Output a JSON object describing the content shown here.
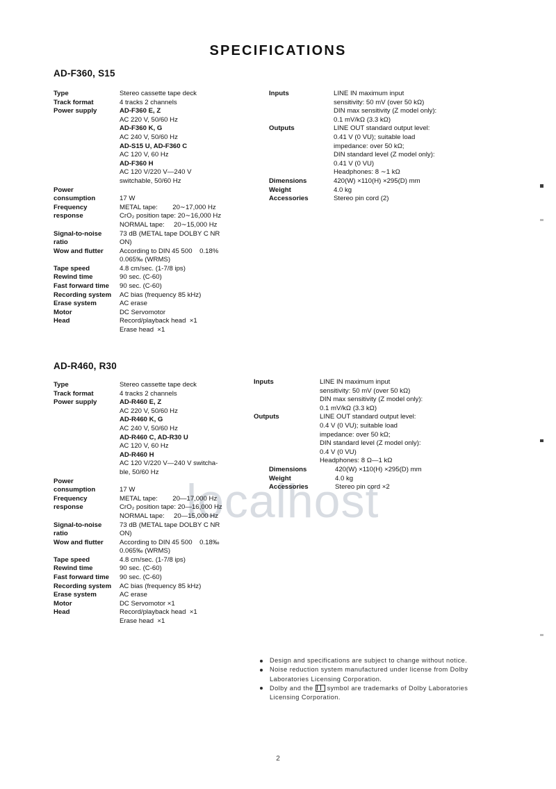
{
  "document": {
    "title": "SPECIFICATIONS",
    "page_number": "2",
    "watermark": "localhost"
  },
  "sections": [
    {
      "heading": "AD-F360, S15",
      "left_rows": [
        {
          "label": "Type",
          "values": [
            {
              "text": "Stereo cassette tape deck",
              "bold": false
            }
          ]
        },
        {
          "label": "Track format",
          "values": [
            {
              "text": "4 tracks 2 channels",
              "bold": false
            }
          ]
        },
        {
          "label": "Power supply",
          "values": [
            {
              "text": "AD-F360 E, Z",
              "bold": true
            },
            {
              "text": "AC 220 V, 50/60 Hz",
              "bold": false
            },
            {
              "text": "AD-F360 K, G",
              "bold": true
            },
            {
              "text": "AC 240 V, 50/60 Hz",
              "bold": false
            },
            {
              "text": "AD-S15 U, AD-F360 C",
              "bold": true
            },
            {
              "text": "AC 120 V, 60 Hz",
              "bold": false
            },
            {
              "text": "AD-F360 H",
              "bold": true
            },
            {
              "text": "AC 120 V/220 V—240 V",
              "bold": false
            },
            {
              "text": "switchable, 50/60 Hz",
              "bold": false
            }
          ]
        },
        {
          "label": "Power\nconsumption",
          "values": [
            {
              "text": "17 W",
              "bold": false
            }
          ]
        },
        {
          "label": "Frequency\nresponse",
          "values": [
            {
              "text": "METAL tape:        20∼17,000 Hz",
              "bold": false
            },
            {
              "text": "CrO₂ position tape: 20∼16,000 Hz",
              "bold": false
            },
            {
              "text": "NORMAL tape:     20∼15,000 Hz",
              "bold": false
            }
          ]
        },
        {
          "label": "Signal-to-noise\nratio",
          "values": [
            {
              "text": "73 dB (METAL tape DOLBY C NR",
              "bold": false
            },
            {
              "text": "ON)",
              "bold": false
            }
          ]
        },
        {
          "label": "Wow and flutter",
          "values": [
            {
              "text": "According to DIN 45 500    0.18%",
              "bold": false
            },
            {
              "text": "0.065‰ (WRMS)",
              "bold": false
            }
          ]
        },
        {
          "label": "Tape speed",
          "values": [
            {
              "text": "4.8 cm/sec. (1-7/8 ips)",
              "bold": false
            }
          ]
        },
        {
          "label": "Rewind time",
          "values": [
            {
              "text": "90 sec. (C-60)",
              "bold": false
            }
          ]
        },
        {
          "label": "Fast forward time",
          "values": [
            {
              "text": "90 sec. (C-60)",
              "bold": false
            }
          ]
        },
        {
          "label": "Recording system",
          "values": [
            {
              "text": "AC bias (frequency 85 kHz)",
              "bold": false
            }
          ]
        },
        {
          "label": "Erase system",
          "values": [
            {
              "text": "AC erase",
              "bold": false
            }
          ]
        },
        {
          "label": "Motor",
          "values": [
            {
              "text": "DC Servomotor",
              "bold": false
            }
          ]
        },
        {
          "label": "Head",
          "values": [
            {
              "text": "Record/playback head  ×1",
              "bold": false
            },
            {
              "text": "Erase head  ×1",
              "bold": false
            }
          ]
        }
      ],
      "right_rows": [
        {
          "label": "Inputs",
          "values": [
            {
              "text": "LINE IN maximum input",
              "bold": false
            },
            {
              "text": "sensitivity: 50 mV (over 50 kΩ)",
              "bold": false
            },
            {
              "text": "DIN max sensitivity (Z model only):",
              "bold": false
            },
            {
              "text": "0.1 mV/kΩ (3.3 kΩ)",
              "bold": false
            }
          ]
        },
        {
          "label": "Outputs",
          "values": [
            {
              "text": "LINE OUT standard output level:",
              "bold": false
            },
            {
              "text": "0.41 V (0 VU); suitable load",
              "bold": false
            },
            {
              "text": "impedance: over 50 kΩ;",
              "bold": false
            },
            {
              "text": "DIN standard level (Z model only):",
              "bold": false
            },
            {
              "text": "0.41 V (0 VU)",
              "bold": false
            },
            {
              "text": "Headphones: 8 ∼1 kΩ",
              "bold": false
            }
          ]
        },
        {
          "label": "Dimensions",
          "values": [
            {
              "text": "420(W) ×110(H) ×295(D) mm",
              "bold": false
            }
          ]
        },
        {
          "label": "Weight",
          "values": [
            {
              "text": "4.0 kg",
              "bold": false
            }
          ]
        },
        {
          "label": "Accessories",
          "values": [
            {
              "text": "Stereo pin cord (2)",
              "bold": false
            }
          ]
        }
      ]
    },
    {
      "heading": "AD-R460, R30",
      "left_rows": [
        {
          "label": "Type",
          "values": [
            {
              "text": "Stereo cassette tape deck",
              "bold": false
            }
          ]
        },
        {
          "label": "Track format",
          "values": [
            {
              "text": "4 tracks 2 channels",
              "bold": false
            }
          ]
        },
        {
          "label": "Power supply",
          "values": [
            {
              "text": "AD-R460 E, Z",
              "bold": true
            },
            {
              "text": "AC 220 V, 50/60 Hz",
              "bold": false
            },
            {
              "text": "AD-R460 K, G",
              "bold": true
            },
            {
              "text": "AC 240 V, 50/60 Hz",
              "bold": false
            },
            {
              "text": "AD-R460 C, AD-R30 U",
              "bold": true
            },
            {
              "text": "AC 120 V, 60 Hz",
              "bold": false
            },
            {
              "text": "AD-R460 H",
              "bold": true
            },
            {
              "text": "AC 120 V/220 V—240 V switcha-",
              "bold": false
            },
            {
              "text": "ble, 50/60 Hz",
              "bold": false
            }
          ]
        },
        {
          "label": "Power\nconsumption",
          "values": [
            {
              "text": "17 W",
              "bold": false
            }
          ]
        },
        {
          "label": "Frequency\nresponse",
          "values": [
            {
              "text": "METAL tape:        20—17,000 Hz",
              "bold": false
            },
            {
              "text": "CrO₂ position tape: 20—16,000 Hz",
              "bold": false
            },
            {
              "text": "NORMAL tape:     20—15,000 Hz",
              "bold": false
            }
          ]
        },
        {
          "label": "Signal-to-noise\nratio",
          "values": [
            {
              "text": "73 dB (METAL tape DOLBY C NR",
              "bold": false
            },
            {
              "text": "ON)",
              "bold": false
            }
          ]
        },
        {
          "label": "Wow and flutter",
          "values": [
            {
              "text": "According to DIN 45 500    0.18‰",
              "bold": false
            },
            {
              "text": "0.065‰ (WRMS)",
              "bold": false
            }
          ]
        },
        {
          "label": "Tape speed",
          "values": [
            {
              "text": "4.8 cm/sec. (1-7/8 ips)",
              "bold": false
            }
          ]
        },
        {
          "label": "Rewind time",
          "values": [
            {
              "text": "90 sec. (C-60)",
              "bold": false
            }
          ]
        },
        {
          "label": "Fast forward time",
          "values": [
            {
              "text": "90 sec. (C-60)",
              "bold": false
            }
          ]
        },
        {
          "label": "Recording system",
          "values": [
            {
              "text": "AC bias (frequency 85 kHz)",
              "bold": false
            }
          ]
        },
        {
          "label": "Erase system",
          "values": [
            {
              "text": "AC erase",
              "bold": false
            }
          ]
        },
        {
          "label": "Motor",
          "values": [
            {
              "text": "DC Servomotor ×1",
              "bold": false
            }
          ]
        },
        {
          "label": "Head",
          "values": [
            {
              "text": "Record/playback head  ×1",
              "bold": false
            },
            {
              "text": "Erase head  ×1",
              "bold": false
            }
          ]
        }
      ],
      "right_rows": [
        {
          "label": "Inputs",
          "values": [
            {
              "text": "LINE IN maximum input",
              "bold": false
            },
            {
              "text": "sensitivity: 50 mV (over 50 kΩ)",
              "bold": false
            },
            {
              "text": "DIN max sensitivity (Z model only):",
              "bold": false
            },
            {
              "text": "0.1 mV/kΩ (3.3 kΩ)",
              "bold": false
            }
          ]
        },
        {
          "label": "Outputs",
          "values": [
            {
              "text": "LINE OUT standard output level:",
              "bold": false
            },
            {
              "text": "0.4 V (0 VU); suitable load",
              "bold": false
            },
            {
              "text": "impedance: over 50 kΩ;",
              "bold": false
            },
            {
              "text": "DIN standard level (Z model only):",
              "bold": false
            },
            {
              "text": "0.4 V (0 VU)",
              "bold": false
            },
            {
              "text": "Headphones: 8 Ω—1 kΩ",
              "bold": false
            }
          ]
        },
        {
          "label": "Dimensions",
          "indent": true,
          "values": [
            {
              "text": "420(W) ×110(H) ×295(D) mm",
              "bold": false
            }
          ]
        },
        {
          "label": "Weight",
          "indent": true,
          "values": [
            {
              "text": "4.0 kg",
              "bold": false
            }
          ]
        },
        {
          "label": "Accessories",
          "indent": true,
          "values": [
            {
              "text": "Stereo pin cord ×2",
              "bold": false
            }
          ]
        }
      ]
    }
  ],
  "footnotes": [
    {
      "parts": [
        {
          "type": "text",
          "text": "Design and specifications are subject to change without notice."
        }
      ]
    },
    {
      "parts": [
        {
          "type": "text",
          "text": "Noise reduction system manufactured under license from Dolby Laboratories Licensing Corporation."
        }
      ]
    },
    {
      "parts": [
        {
          "type": "text",
          "text": "Dolby and the "
        },
        {
          "type": "dolby-symbol"
        },
        {
          "type": "text",
          "text": " symbol are trademarks of Dolby Laboratories Licensing Corporation."
        }
      ]
    }
  ]
}
